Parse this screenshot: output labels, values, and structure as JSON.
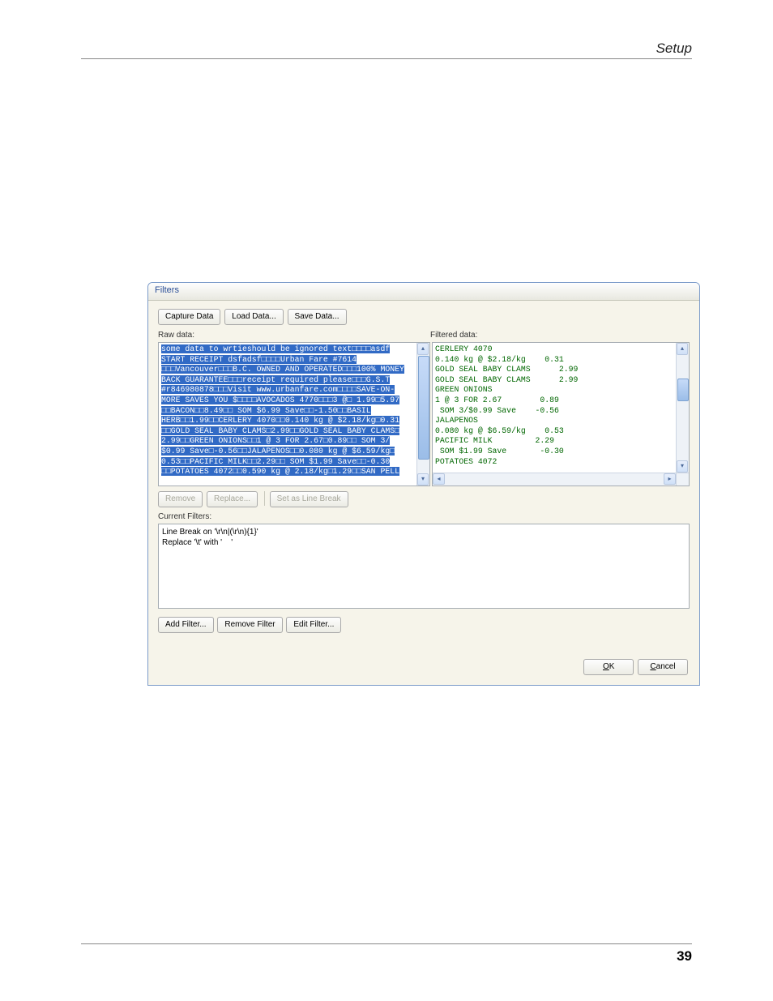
{
  "page": {
    "header": "Setup",
    "number": "39"
  },
  "dialog": {
    "title": "Filters",
    "toolbar": {
      "capture": "Capture Data",
      "load": "Load Data...",
      "save": "Save Data..."
    },
    "rawLabel": "Raw data:",
    "filteredLabel": "Filtered data:",
    "rawData": "some data to wrtieshould be ignored text□□□□asdf\nSTART RECEIPT dsfadsf□□□□Urban Fare #7614\n□□□Vancouver□□□B.C. OWNED AND OPERATED□□□100% MONEY\nBACK GUARANTEE□□□receipt required please□□□G.S.T\n#r846980878□□□Visit www.urbanfare.com□□□□SAVE-ON-\nMORE SAVES YOU $□□□□AVOCADOS 4770□□□3 @□ 1.99□5.97\n□□BACON□□8.49□□ SOM $6.99 Save□□-1.50□□BASIL\nHERB□□1.99□□CERLERY 4070□□0.140 kg @ $2.18/kg□0.31\n□□GOLD SEAL BABY CLAMS□2.99□□GOLD SEAL BABY CLAMS□\n2.99□□GREEN ONIONS□□1 @ 3 FOR 2.67□0.89□□ SOM 3/\n$0.99 Save□-0.56□□JALAPENOS□□0.080 kg @ $6.59/kg□\n0.53□□PACIFIC MILK□□2.29□□ SOM $1.99 Save□□-0.30\n□□POTATOES 4072□□0.590 kg @ 2.18/kg□1.29□□SAN PELL",
    "filteredData": "CERLERY 4070\n0.140 kg @ $2.18/kg    0.31\nGOLD SEAL BABY CLAMS      2.99\nGOLD SEAL BABY CLAMS      2.99\nGREEN ONIONS\n1 @ 3 FOR 2.67        0.89\n SOM 3/$0.99 Save    -0.56\nJALAPENOS\n0.080 kg @ $6.59/kg    0.53\nPACIFIC MILK         2.29\n SOM $1.99 Save       -0.30\nPOTATOES 4072",
    "mid": {
      "remove": "Remove",
      "replace": "Replace...",
      "setlb": "Set as Line Break"
    },
    "currentFiltersLabel": "Current Filters:",
    "currentFilters": "Line Break on '\\r\\n|(\\r\\n){1}'\nReplace '\\t' with '    '",
    "bottom": {
      "add": "Add Filter...",
      "remove": "Remove Filter",
      "edit": "Edit Filter..."
    },
    "ok": "OK",
    "cancel": "Cancel"
  }
}
